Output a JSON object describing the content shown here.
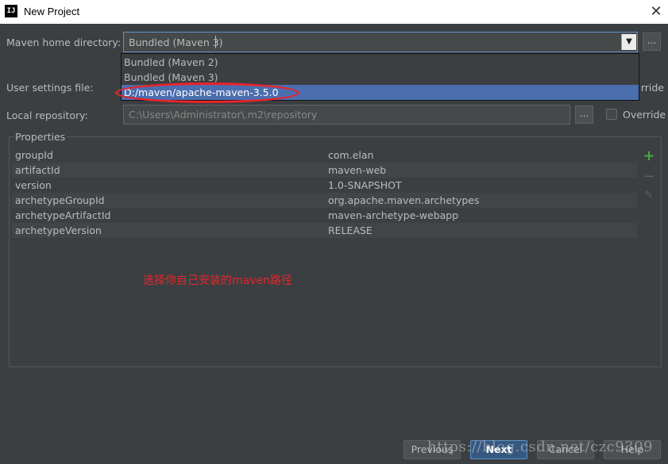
{
  "window": {
    "title": "New Project",
    "app_icon": "IJ"
  },
  "maven_home": {
    "label": "Maven home directory:",
    "value": "Bundled (Maven 3)",
    "options": [
      "Bundled (Maven 2)",
      "Bundled (Maven 3)",
      "D:/maven/apache-maven-3.5.0"
    ],
    "selected_index": 2
  },
  "user_settings": {
    "label": "User settings file:",
    "override_label": "Override"
  },
  "local_repo": {
    "label": "Local repository:",
    "value": "C:\\Users\\Administrator\\.m2\\repository",
    "override_label": "Override"
  },
  "browse_label": "...",
  "properties": {
    "title": "Properties",
    "rows": [
      {
        "key": "groupId",
        "value": "com.elan"
      },
      {
        "key": "artifactId",
        "value": "maven-web"
      },
      {
        "key": "version",
        "value": "1.0-SNAPSHOT"
      },
      {
        "key": "archetypeGroupId",
        "value": "org.apache.maven.archetypes"
      },
      {
        "key": "archetypeArtifactId",
        "value": "maven-archetype-webapp"
      },
      {
        "key": "archetypeVersion",
        "value": "RELEASE"
      }
    ]
  },
  "annotation": "选择你自己安装的maven路径",
  "buttons": {
    "previous": "Previous",
    "next": "Next",
    "cancel": "Cancel",
    "help": "Help"
  },
  "watermark": "https://blog.csdn.net/czc9309",
  "colors": {
    "highlight": "#4b6eaf",
    "annotation_red": "#e8242b",
    "add_green": "#49a548"
  }
}
